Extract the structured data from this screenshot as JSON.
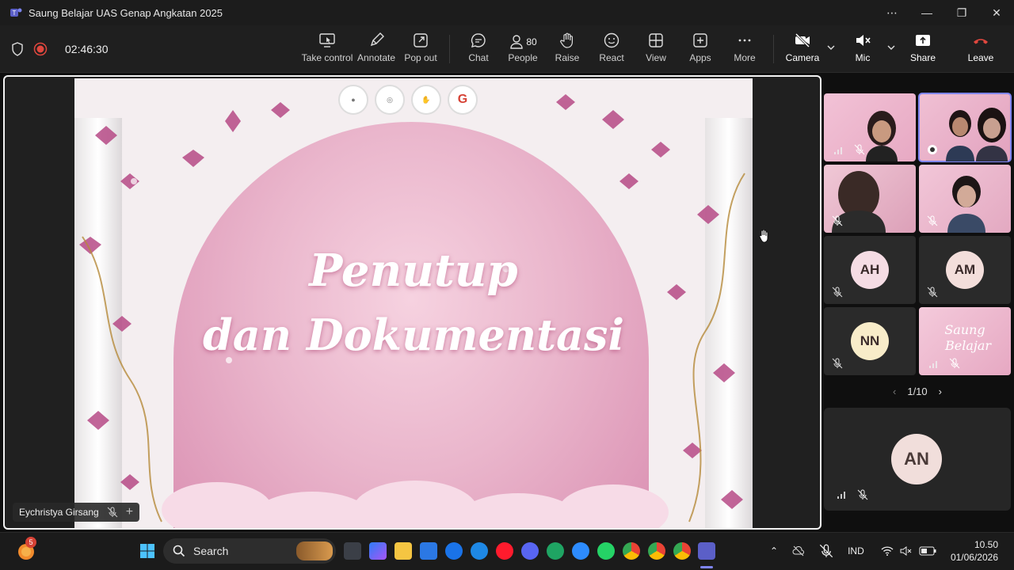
{
  "window": {
    "title": "Saung Belajar UAS Genap Angkatan 2025"
  },
  "meeting": {
    "timer": "02:46:30"
  },
  "toolbar": {
    "take_control": "Take control",
    "annotate": "Annotate",
    "pop_out": "Pop out",
    "chat": "Chat",
    "people_count": "80",
    "people": "People",
    "raise": "Raise",
    "react": "React",
    "view": "View",
    "apps": "Apps",
    "more": "More",
    "camera": "Camera",
    "mic": "Mic",
    "share": "Share",
    "leave": "Leave"
  },
  "slide": {
    "line1": "Penutup",
    "line2": "dan Dokumentasi",
    "presenter": "Eychristya Girsang"
  },
  "participants": {
    "tiles": [
      {
        "initials": "AH",
        "color": "#f5dce4"
      },
      {
        "initials": "AM",
        "color": "#f3dedb"
      },
      {
        "initials": "NN",
        "color": "#f8ecc9"
      }
    ],
    "page": "1/10",
    "featured": "AN"
  },
  "taskbar": {
    "search": "Search",
    "badge_count": "5",
    "language": "IND",
    "time": "10.50",
    "date": "01/06/2026"
  },
  "colors": {
    "accent": "#7f85f5",
    "leave": "#e0473e"
  }
}
